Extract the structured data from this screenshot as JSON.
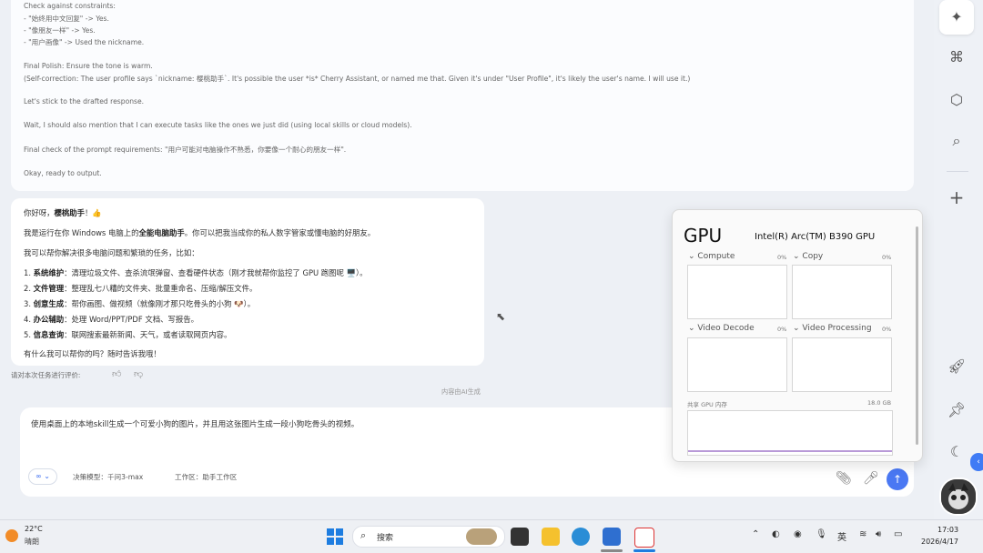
{
  "thinking": {
    "lines": [
      "Check against constraints:",
      "- \"始终用中文回复\" -> Yes.",
      "- \"像朋友一样\" -> Yes.",
      "- \"用户画像\" -> Used the nickname.",
      "Final Polish: Ensure the tone is warm.",
      "(Self-correction: The user profile says `nickname: 樱桃助手`. It's possible the user *is* Cherry Assistant, or named me that. Given it's under \"User Profile\", it's likely the user's name. I will use it.)",
      "Let's stick to the drafted response.",
      "Wait, I should also mention that I can execute tasks like the ones we just did (using local skills or cloud models).",
      "Final check of the prompt requirements: \"用户可能对电脑操作不熟悉，你要像一个耐心的朋友一样\".",
      "Okay, ready to output."
    ]
  },
  "reply": {
    "greeting_pre": "你好呀，",
    "greeting_name": "樱桃助手",
    "greeting_post": "！👍",
    "intro_pre": "我是运行在你 Windows 电脑上的",
    "intro_bold": "全能电脑助手",
    "intro_post": "。你可以把我当成你的私人数字管家或懂电脑的好朋友。",
    "can_help": "我可以帮你解决很多电脑问题和繁琐的任务，比如：",
    "items": [
      {
        "num": "1.",
        "title": "系统维护",
        "text": "：清理垃圾文件、查杀流氓弹窗、查看硬件状态（刚才我就帮你监控了 GPU 跑图呢 🖥️）。"
      },
      {
        "num": "2.",
        "title": "文件管理",
        "text": "：整理乱七八糟的文件夹、批量重命名、压缩/解压文件。"
      },
      {
        "num": "3.",
        "title": "创意生成",
        "text": "：帮你画图、做视频（就像刚才那只吃骨头的小狗 🐶）。"
      },
      {
        "num": "4.",
        "title": "办公辅助",
        "text": "：处理 Word/PPT/PDF 文档、写报告。"
      },
      {
        "num": "5.",
        "title": "信息查询",
        "text": "：联网搜索最新新闻、天气，或者读取网页内容。"
      }
    ],
    "closing": "有什么我可以帮你的吗？随时告诉我哦！"
  },
  "feedback_label": "请对本次任务进行评价:",
  "ai_generated": "内容由AI生成",
  "input": {
    "text": "使用桌面上的本地skill生成一个可爱小狗的图片，并且用这张图片生成一段小狗吃骨头的视频。",
    "model_label": "决策模型：千问3-max",
    "workspace_label": "工作区：助手工作区"
  },
  "gpu": {
    "title": "GPU",
    "name": "Intel(R) Arc(TM) B390 GPU",
    "graphs": [
      {
        "label": "Compute",
        "percent": "0%"
      },
      {
        "label": "Copy",
        "percent": "0%"
      },
      {
        "label": "Video Decode",
        "percent": "0%"
      },
      {
        "label": "Video Processing",
        "percent": "0%"
      }
    ],
    "memory_label": "共享 GPU 内存",
    "memory_total": "18.0 GB"
  },
  "taskbar": {
    "weather_temp": "22°C",
    "weather_desc": "晴朗",
    "search_label": "搜索",
    "ime": "英",
    "time": "17:03",
    "date": "2026/4/17"
  },
  "icons": [
    "sparkle-icon",
    "grid-icon",
    "cube-icon",
    "search-icon",
    "plus-icon",
    "rocket-icon",
    "pin-icon",
    "moon-icon",
    "paperclip-icon",
    "mic-icon",
    "send-icon"
  ]
}
